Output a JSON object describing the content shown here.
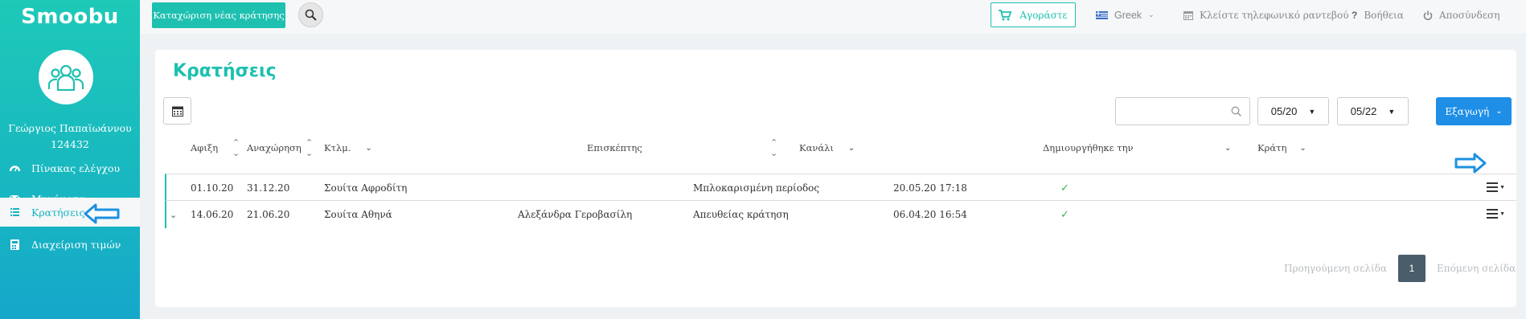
{
  "app": {
    "logo": "Smoobu"
  },
  "user": {
    "name": "Γεώργιος Παπαϊωάννου",
    "id": "124432"
  },
  "sidebar": {
    "items": [
      {
        "label": "Πίνακας ελέγχου",
        "icon": "dashboard-icon"
      },
      {
        "label": "Μηνύματα",
        "icon": "envelope-icon"
      },
      {
        "label": "Κρατήσεις",
        "icon": "list-icon",
        "active": true
      },
      {
        "label": "Διαχείριση τιμών",
        "icon": "calculator-icon"
      }
    ]
  },
  "topbar": {
    "new_booking": "Καταχώριση νέας κράτησης",
    "buy": "Αγοράστε",
    "language": "Greek",
    "phone_appointment": "Κλείστε τηλεφωνικό ραντεβού",
    "help": "Βοήθεια",
    "logout": "Αποσύνδεση"
  },
  "page": {
    "title": "Κρατήσεις"
  },
  "filters": {
    "search_placeholder": "",
    "from": "05/20",
    "to": "05/22",
    "export": "Εξαγωγή"
  },
  "table": {
    "headers": [
      "Αφιξη",
      "Αναχώρηση",
      "Κτλμ.",
      "Επισκέπτης",
      "Κανάλι",
      "Δημιουργήθηκε την",
      "Κράτη"
    ],
    "rows": [
      {
        "arrival": "01.10.20",
        "departure": "31.12.20",
        "unit": "Σουίτα Αφροδίτη",
        "guest": "",
        "channel": "Μπλοκαρισμένη περίοδος",
        "created": "20.05.20 17:18",
        "booked": "✓"
      },
      {
        "arrival": "14.06.20",
        "departure": "21.06.20",
        "unit": "Σουίτα Αθηνά",
        "guest": "Αλεξάνδρα Γεροβασίλη",
        "channel": "Απευθείας κράτηση",
        "created": "06.04.20 16:54",
        "booked": "✓"
      }
    ]
  },
  "pagination": {
    "prev": "Προηγούμενη σελίδα",
    "current": "1",
    "next": "Επόμενη σελίδα"
  },
  "colors": {
    "accent": "#1ec0b0",
    "export": "#1e8ee6",
    "pointer_arrow": "#1e90e0"
  }
}
